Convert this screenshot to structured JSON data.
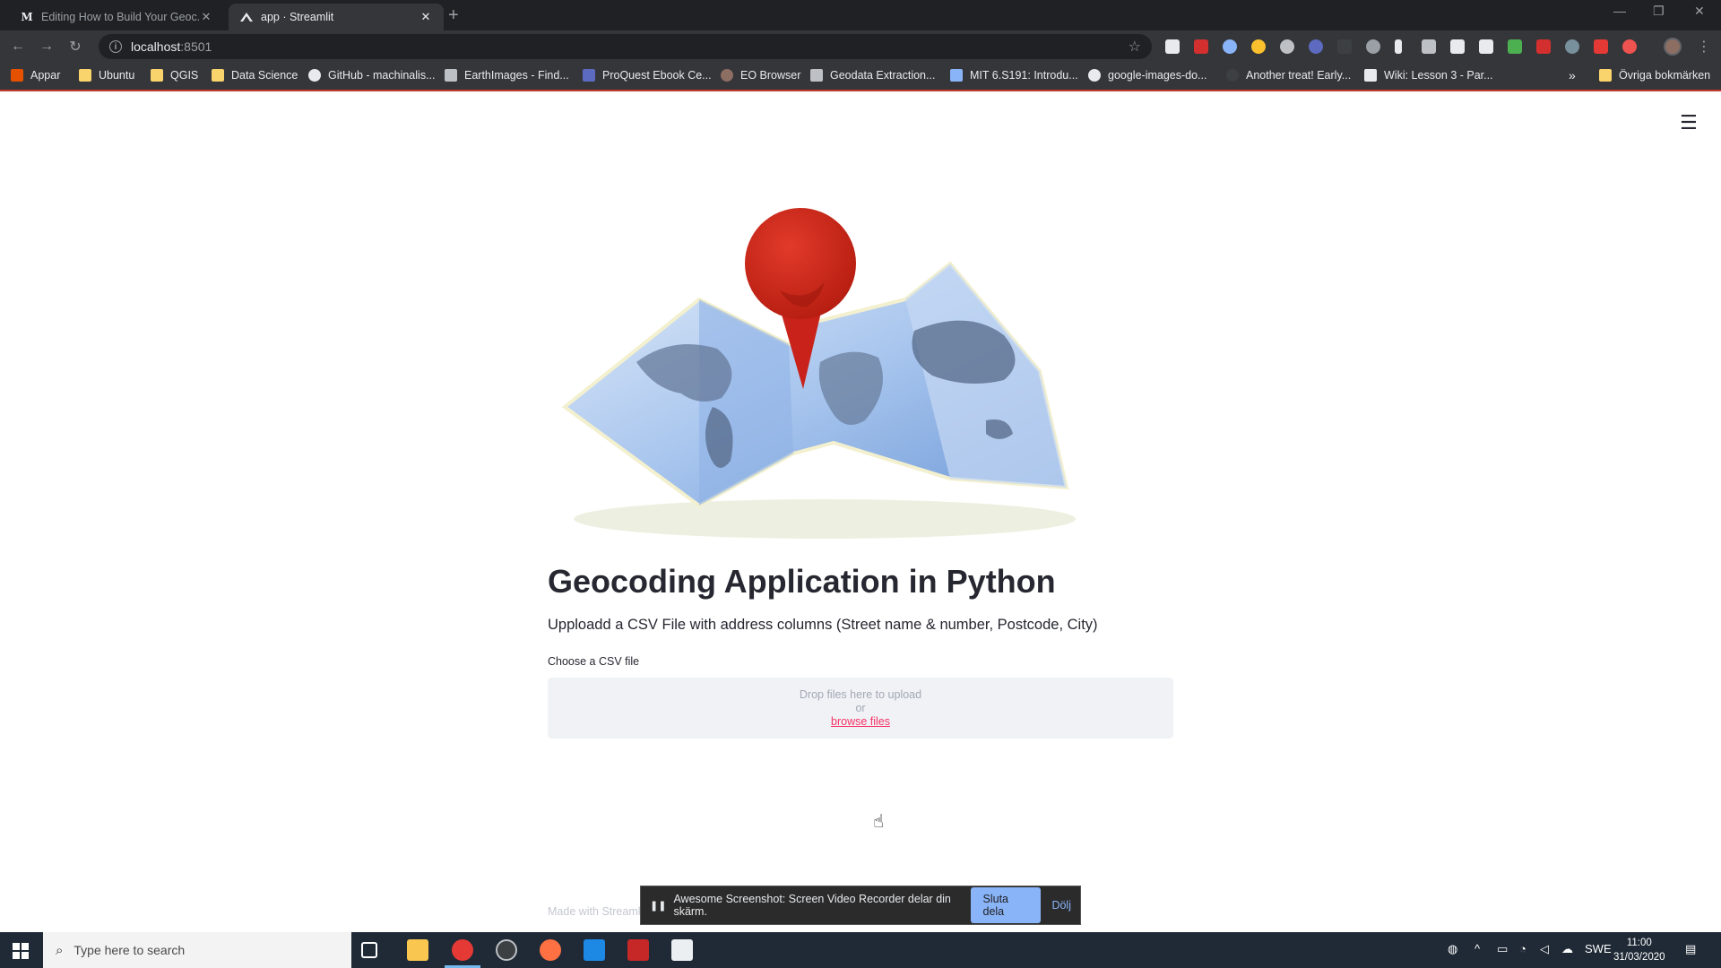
{
  "browser": {
    "tabs": [
      {
        "favicon": "M",
        "title": "Editing How to Build Your Geoc...",
        "active": false
      },
      {
        "favicon": "streamlit-icon",
        "title": "app · Streamlit",
        "active": true
      }
    ],
    "address": {
      "host": "localhost",
      "port": ":8501"
    },
    "bookmarks": [
      {
        "label": "Appar",
        "icon": "apps-grid-icon"
      },
      {
        "label": "Ubuntu",
        "icon": "folder-icon"
      },
      {
        "label": "QGIS",
        "icon": "folder-icon"
      },
      {
        "label": "Data Science",
        "icon": "folder-icon"
      },
      {
        "label": "GitHub - machinalis...",
        "icon": "github-icon"
      },
      {
        "label": "EarthImages - Find...",
        "icon": "page-icon"
      },
      {
        "label": "ProQuest Ebook Ce...",
        "icon": "page-icon"
      },
      {
        "label": "EO Browser",
        "icon": "globe-icon"
      },
      {
        "label": "Geodata Extraction...",
        "icon": "page-icon"
      },
      {
        "label": "MIT 6.S191: Introdu...",
        "icon": "page-icon"
      },
      {
        "label": "google-images-do...",
        "icon": "github-icon"
      },
      {
        "label": "Another treat! Early...",
        "icon": "github-icon"
      },
      {
        "label": "Wiki: Lesson 3 - Par...",
        "icon": "page-icon"
      }
    ],
    "bookmarks_more": "»",
    "other_bookmarks": "Övriga bokmärken"
  },
  "app": {
    "title": "Geocoding Application in Python",
    "subtitle": "Upploadd a CSV File with address columns (Street name & number, Postcode, City)",
    "uploader": {
      "label": "Choose a CSV file",
      "drop_text": "Drop files here to upload",
      "or_text": "or",
      "browse_text": "browse files"
    },
    "footer": "Made with Streamlit"
  },
  "share_bar": {
    "message": "Awesome Screenshot: Screen Video Recorder delar din skärm.",
    "stop_label": "Sluta dela",
    "hide_label": "Dölj"
  },
  "taskbar": {
    "search_placeholder": "Type here to search",
    "language": "SWE",
    "time": "11:00",
    "date": "31/03/2020"
  },
  "colors": {
    "streamlit_accent": "#f63366",
    "chrome_dark": "#202124",
    "taskbar": "#1f2a36"
  }
}
